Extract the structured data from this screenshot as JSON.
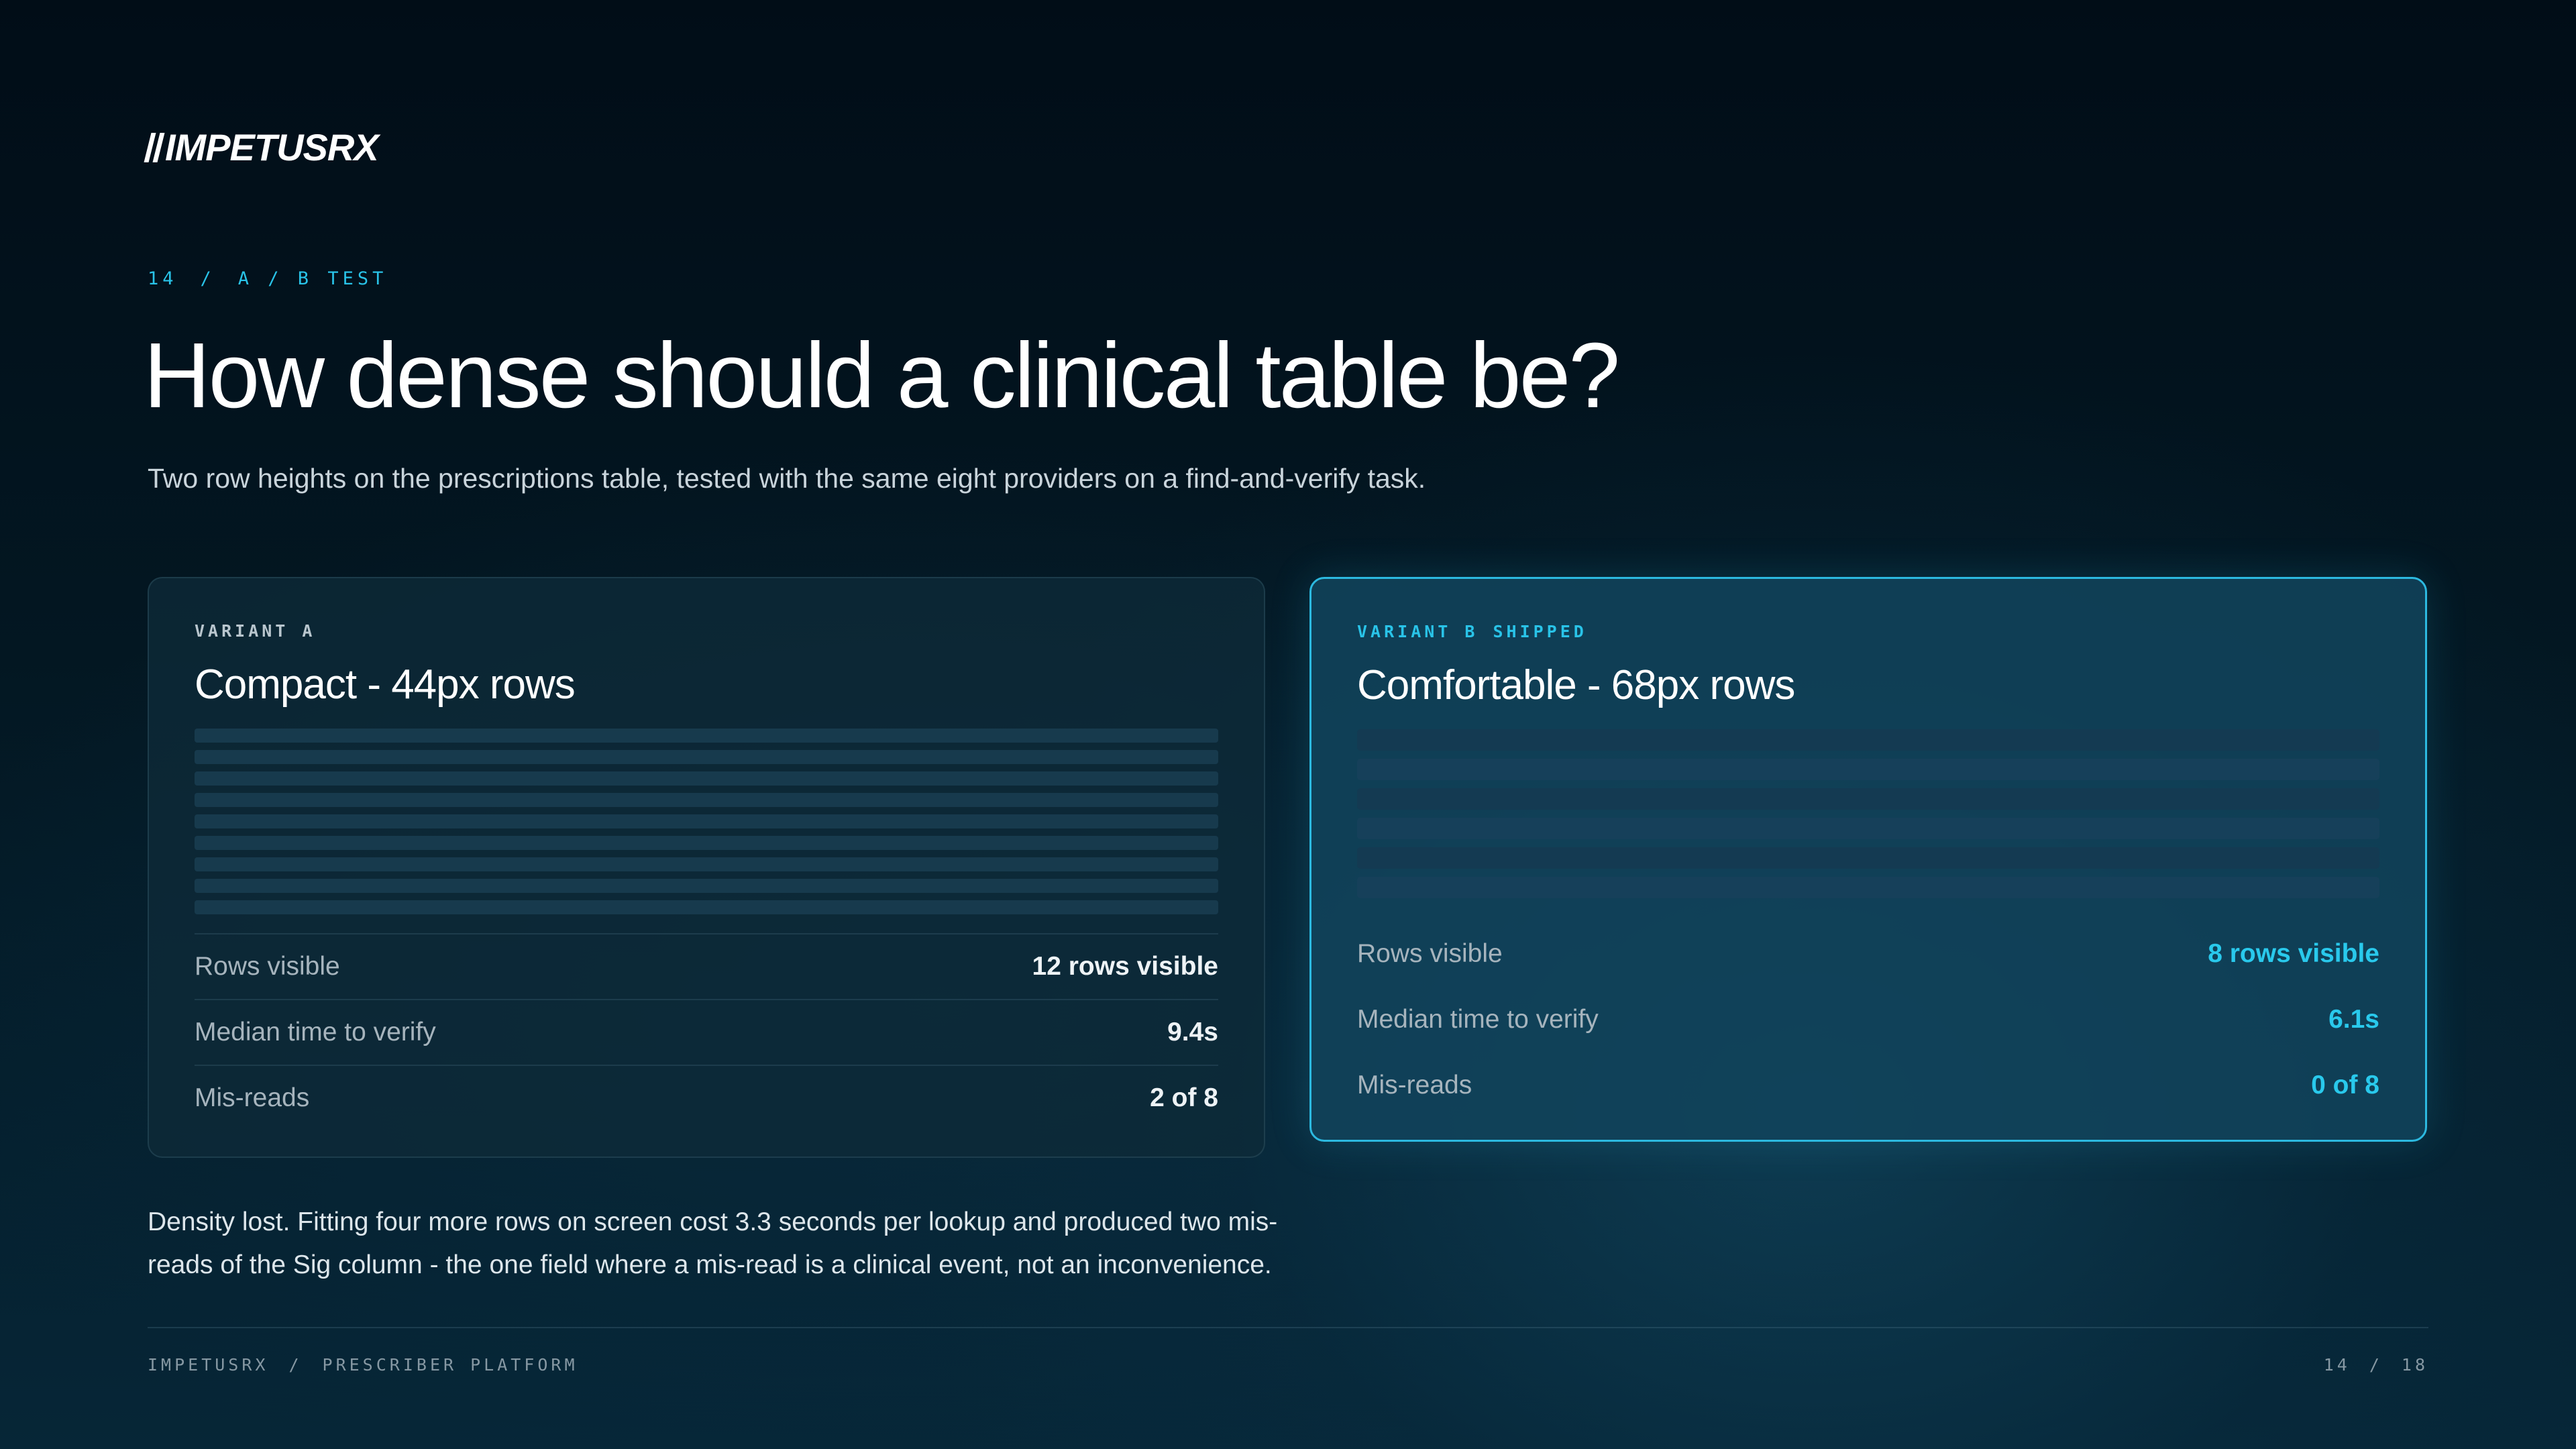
{
  "brand": {
    "logo_text": "IMPETUSRX"
  },
  "kicker": {
    "slide_number": "14",
    "separator": "/",
    "label": "A / B TEST"
  },
  "title": "How dense should a clinical table be?",
  "subtitle": "Two row heights on the prescriptions table, tested with the same eight providers on a find-and-verify task.",
  "variants": [
    {
      "label": "VARIANT A",
      "badge": "",
      "title": "Compact - 44px rows",
      "stats": [
        {
          "label": "Rows visible",
          "value": "12 rows visible"
        },
        {
          "label": "Median time to verify",
          "value": "9.4s"
        },
        {
          "label": "Mis-reads",
          "value": "2 of 8"
        }
      ]
    },
    {
      "label": "VARIANT B",
      "badge": "SHIPPED",
      "title": "Comfortable - 68px rows",
      "stats": [
        {
          "label": "Rows visible",
          "value": "8 rows visible"
        },
        {
          "label": "Median time to verify",
          "value": "6.1s"
        },
        {
          "label": "Mis-reads",
          "value": "0 of 8"
        }
      ]
    }
  ],
  "conclusion": "Density lost. Fitting four more rows on screen cost 3.3 seconds per lookup and produced two mis-reads of the Sig column - the one field where a mis-read is a clinical event, not an inconvenience.",
  "footer": {
    "company": "IMPETUSRX",
    "separator": "/",
    "section": "PRESCRIBER PLATFORM",
    "page_current": "14",
    "page_total": "18"
  },
  "colors": {
    "accent": "#29c3e8",
    "background": "#031722",
    "card_a": "#0e2a38",
    "card_b": "#11435b"
  }
}
